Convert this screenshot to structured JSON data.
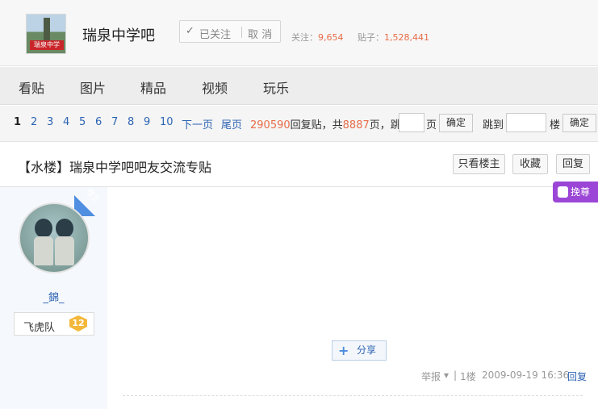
{
  "header": {
    "forum_name": "瑞泉中学吧",
    "logo_text": "瑞泉中学",
    "follow_check": "✓",
    "follow_status": "已关注",
    "follow_cancel": "取 消",
    "follow_label": "关注：",
    "follow_count": "9,654",
    "posts_label": "贴子：",
    "posts_count": "1,528,441"
  },
  "nav": {
    "items": [
      "看贴",
      "图片",
      "精品",
      "视频",
      "玩乐"
    ]
  },
  "pager": {
    "pages": [
      "1",
      "2",
      "3",
      "4",
      "5",
      "6",
      "7",
      "8",
      "9",
      "10"
    ],
    "next": "下一页",
    "last": "尾页",
    "reply_count": "290590",
    "reply_label": "回复贴，共",
    "page_total": "8887",
    "page_label": "页，跳到",
    "page_unit": "页",
    "confirm": "确定",
    "jump_floor": "跳到",
    "floor_unit": "楼",
    "confirm2": "确定"
  },
  "thread": {
    "title": "【水楼】瑞泉中学吧吧友交流专贴",
    "only_owner": "只看楼主",
    "favorite": "收藏",
    "reply": "回复"
  },
  "post": {
    "ribbon": "楼主",
    "username": "_錦_",
    "badge_name": "飞虎队",
    "badge_level": "12",
    "gift_label": "挽尊",
    "share_label": "分享",
    "share_icon": "plus-icon",
    "report": "举报",
    "caret": "▾",
    "divider": "|",
    "floor": "1楼",
    "date": "2009-09-19 16:36",
    "reply": "回复"
  },
  "colors": {
    "link": "#2d64b3",
    "accent": "#e86c48",
    "gift": "#9b46d6",
    "ribbon": "#4f8ee0"
  }
}
